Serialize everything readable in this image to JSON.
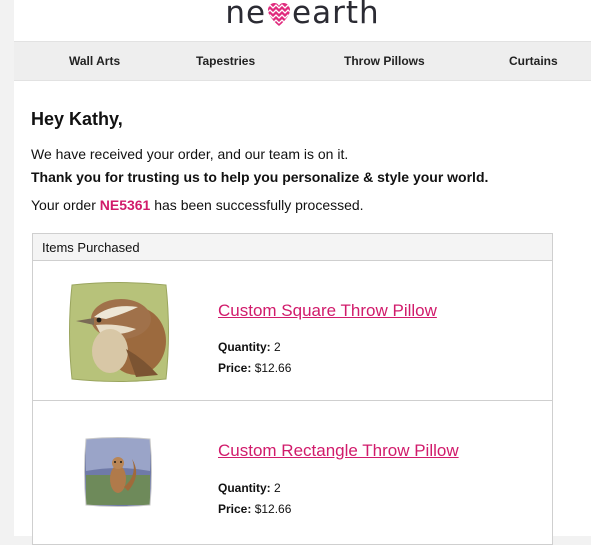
{
  "brand": {
    "logo_left": "ne",
    "logo_right": " earth",
    "accent": "#d11b6b"
  },
  "nav": {
    "items": [
      "Wall Arts",
      "Tapestries",
      "Throw Pillows",
      "Curtains"
    ]
  },
  "message": {
    "greeting": "Hey Kathy,",
    "line1": "We have received your order, and our team is on it.",
    "line2": "Thank you for trusting us to help you personalize & style your world.",
    "order_prefix": "Your order ",
    "order_number": "NE5361",
    "order_suffix": " has been successfully processed."
  },
  "items_section": {
    "title": "Items Purchased",
    "items": [
      {
        "name": "Custom Square Throw Pillow",
        "quantity_label": "Quantity:",
        "quantity": "2",
        "price_label": "Price:",
        "price": "$12.66",
        "image_icon": "bird-pillow-image"
      },
      {
        "name": "Custom Rectangle Throw Pillow",
        "quantity_label": "Quantity:",
        "quantity": "2",
        "price_label": "Price:",
        "price": "$12.66",
        "image_icon": "squirrel-pillow-image"
      }
    ]
  }
}
